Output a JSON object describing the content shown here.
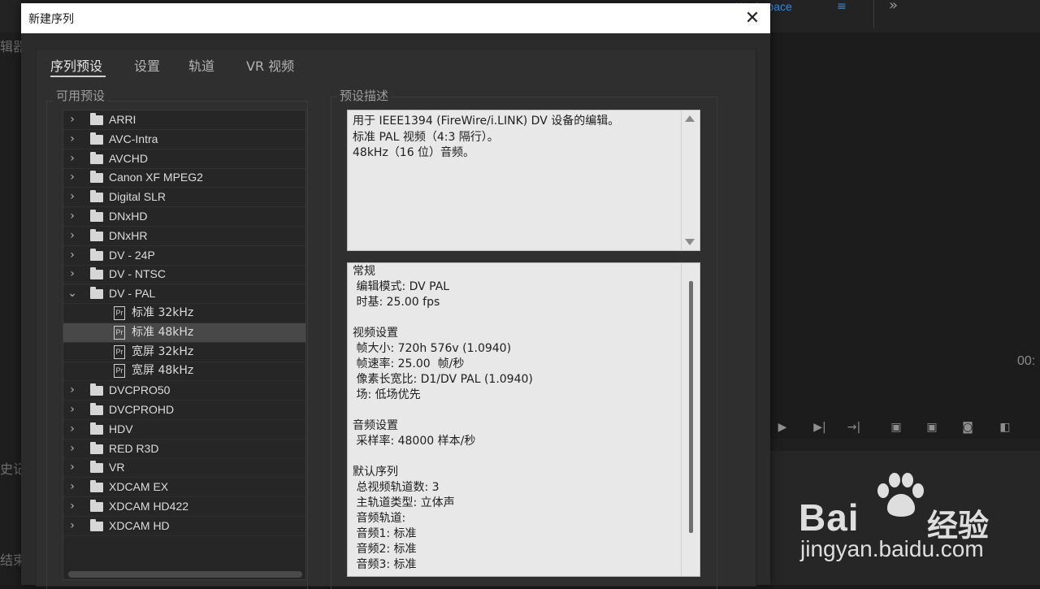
{
  "background": {
    "workspace_label": "Workspace",
    "workspace_menu_icon": "hamburger-icon",
    "overflow_icon": "double-chevron-right-icon",
    "timecode": "00:",
    "left_fragments": [
      "辑器",
      "史记",
      "结束"
    ],
    "watermark": {
      "brand": "Bai",
      "brand_cn": "经验",
      "url": "jingyan.baidu.com"
    }
  },
  "dialog": {
    "title": "新建序列",
    "close_icon": "close-icon",
    "tabs": [
      {
        "label": "序列预设",
        "active": true
      },
      {
        "label": "设置",
        "active": false
      },
      {
        "label": "轨道",
        "active": false
      },
      {
        "label": "VR 视频",
        "active": false
      }
    ],
    "available_presets_label": "可用预设",
    "preset_description_label": "预设描述",
    "presets": [
      {
        "label": "ARRI",
        "type": "folder",
        "expanded": false,
        "level": 0
      },
      {
        "label": "AVC-Intra",
        "type": "folder",
        "expanded": false,
        "level": 0
      },
      {
        "label": "AVCHD",
        "type": "folder",
        "expanded": false,
        "level": 0
      },
      {
        "label": "Canon XF MPEG2",
        "type": "folder",
        "expanded": false,
        "level": 0
      },
      {
        "label": "Digital SLR",
        "type": "folder",
        "expanded": false,
        "level": 0
      },
      {
        "label": "DNxHD",
        "type": "folder",
        "expanded": false,
        "level": 0
      },
      {
        "label": "DNxHR",
        "type": "folder",
        "expanded": false,
        "level": 0
      },
      {
        "label": "DV - 24P",
        "type": "folder",
        "expanded": false,
        "level": 0
      },
      {
        "label": "DV - NTSC",
        "type": "folder",
        "expanded": false,
        "level": 0
      },
      {
        "label": "DV - PAL",
        "type": "folder",
        "expanded": true,
        "level": 0
      },
      {
        "label": "标准 32kHz",
        "type": "preset",
        "level": 1
      },
      {
        "label": "标准 48kHz",
        "type": "preset",
        "level": 1,
        "selected": true
      },
      {
        "label": "宽屏 32kHz",
        "type": "preset",
        "level": 1
      },
      {
        "label": "宽屏 48kHz",
        "type": "preset",
        "level": 1
      },
      {
        "label": "DVCPRO50",
        "type": "folder",
        "expanded": false,
        "level": 0
      },
      {
        "label": "DVCPROHD",
        "type": "folder",
        "expanded": false,
        "level": 0
      },
      {
        "label": "HDV",
        "type": "folder",
        "expanded": false,
        "level": 0
      },
      {
        "label": "RED R3D",
        "type": "folder",
        "expanded": false,
        "level": 0
      },
      {
        "label": "VR",
        "type": "folder",
        "expanded": false,
        "level": 0
      },
      {
        "label": "XDCAM EX",
        "type": "folder",
        "expanded": false,
        "level": 0
      },
      {
        "label": "XDCAM HD422",
        "type": "folder",
        "expanded": false,
        "level": 0
      },
      {
        "label": "XDCAM HD",
        "type": "folder",
        "expanded": false,
        "level": 0
      }
    ],
    "preset_badge": "Pr",
    "description": "用于 IEEE1394 (FireWire/i.LINK) DV 设备的编辑。\n标准 PAL 视频（4:3 隔行）。\n48kHz（16 位）音频。",
    "info_lines": [
      "常规",
      " 编辑模式: DV PAL",
      " 时基: 25.00 fps",
      "",
      "视频设置",
      " 帧大小: 720h 576v (1.0940)",
      " 帧速率: 25.00  帧/秒",
      " 像素长宽比: D1/DV PAL (1.0940)",
      " 场: 低场优先",
      "",
      "音频设置",
      " 采样率: 48000 样本/秒",
      "",
      "默认序列",
      " 总视频轨道数: 3",
      " 主轨道类型: 立体声",
      " 音频轨道:",
      " 音频1: 标准",
      " 音频2: 标准",
      " 音频3: 标准"
    ]
  }
}
